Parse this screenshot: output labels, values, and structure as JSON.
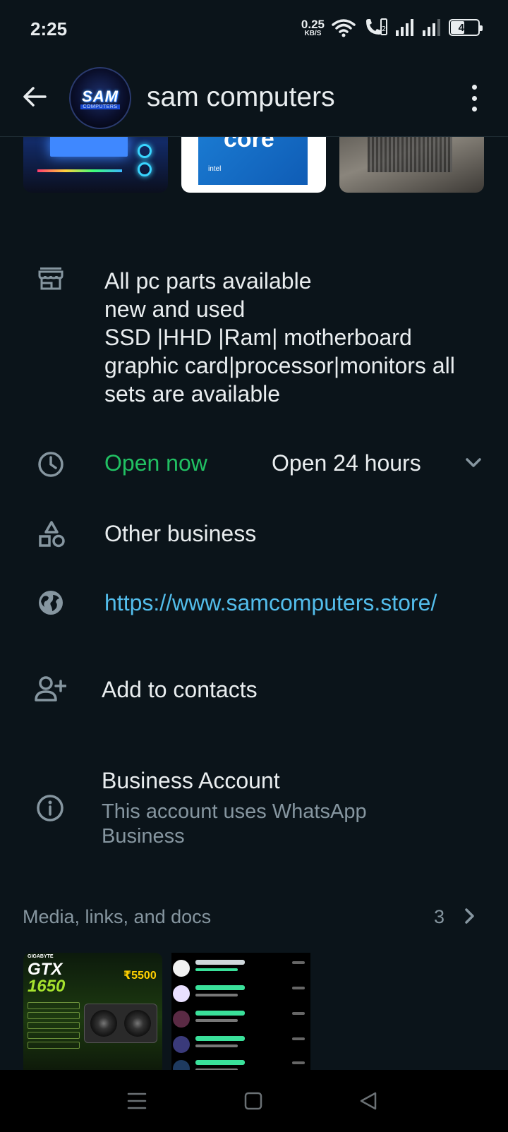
{
  "status_bar": {
    "time": "2:25",
    "net_speed": "0.25",
    "net_unit": "KB/S",
    "battery": "48"
  },
  "header": {
    "title": "sam computers",
    "avatar_text": "SAM",
    "avatar_subtext": "COMPUTERS"
  },
  "catalog": {
    "thumb2_text": "core",
    "thumb2_brand": "intel"
  },
  "description": {
    "lines": [
      "All pc parts available",
      "new and used",
      "SSD |HHD |Ram| motherboard",
      "graphic card|processor|monitors all",
      "sets are available"
    ]
  },
  "hours": {
    "status": "Open now",
    "detail": "Open 24 hours"
  },
  "category": "Other business",
  "website": "https://www.samcomputers.store/",
  "add_contacts": "Add to contacts",
  "business_account": {
    "title": "Business Account",
    "subtitle": "This account uses WhatsApp Business"
  },
  "media": {
    "heading": "Media, links, and docs",
    "count": "3",
    "thumb1": {
      "brand": "GIGABYTE",
      "model": "GTX",
      "number": "1650",
      "price": "₹5500"
    }
  },
  "colors": {
    "background": "#0b141a",
    "accent_green": "#21c063",
    "link_blue": "#53bdeb",
    "secondary_text": "#8696a0"
  }
}
